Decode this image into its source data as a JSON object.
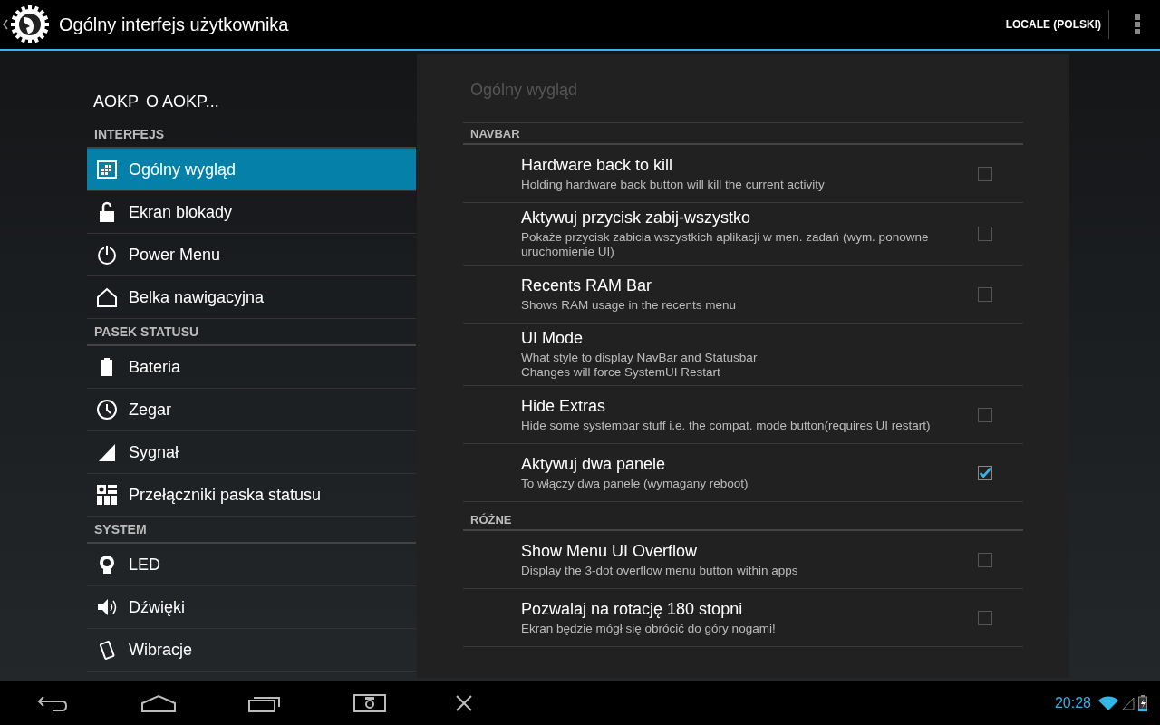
{
  "action_bar": {
    "title": "Ogólny interfejs użytkownika",
    "action": "LOCALE (POLSKI)"
  },
  "sidebar": {
    "header": {
      "logo_text": "AOKP",
      "label": "O AOKP..."
    },
    "sections": [
      {
        "title": "INTERFEJS",
        "items": [
          {
            "label": "Ogólny wygląd",
            "selected": true
          },
          {
            "label": "Ekran blokady",
            "selected": false
          },
          {
            "label": "Power Menu",
            "selected": false
          },
          {
            "label": "Belka nawigacyjna",
            "selected": false
          }
        ]
      },
      {
        "title": "PASEK STATUSU",
        "items": [
          {
            "label": "Bateria",
            "selected": false
          },
          {
            "label": "Zegar",
            "selected": false
          },
          {
            "label": "Sygnał",
            "selected": false
          },
          {
            "label": "Przełączniki paska statusu",
            "selected": false
          }
        ]
      },
      {
        "title": "SYSTEM",
        "items": [
          {
            "label": "LED",
            "selected": false
          },
          {
            "label": "Dźwięki",
            "selected": false
          },
          {
            "label": "Wibracje",
            "selected": false
          }
        ]
      }
    ]
  },
  "panel": {
    "title": "Ogólny wygląd",
    "categories": [
      {
        "title": "NAVBAR",
        "prefs": [
          {
            "kind": "checkbox",
            "title": "Hardware back to kill",
            "summary": [
              "Holding hardware back button will kill the current activity"
            ],
            "checked": false
          },
          {
            "kind": "checkbox",
            "title": "Aktywuj przycisk zabij-wszystko",
            "summary": [
              "Pokaże przycisk zabicia wszystkich aplikacji w men. zadań (wym. ponowne uruchomienie UI)"
            ],
            "checked": false
          },
          {
            "kind": "checkbox",
            "title": "Recents RAM Bar",
            "summary": [
              "Shows RAM usage in the recents menu"
            ],
            "checked": false
          },
          {
            "kind": "list",
            "title": "UI Mode",
            "summary": [
              "What style to display NavBar and Statusbar",
              "Changes will force SystemUI Restart"
            ]
          },
          {
            "kind": "checkbox",
            "title": "Hide Extras",
            "summary": [
              "Hide some systembar stuff i.e. the compat. mode button(requires UI restart)"
            ],
            "checked": false
          },
          {
            "kind": "checkbox",
            "title": "Aktywuj dwa panele",
            "summary": [
              "To włączy dwa panele (wymagany reboot)"
            ],
            "checked": true
          }
        ]
      },
      {
        "title": "RÓŻNE",
        "prefs": [
          {
            "kind": "checkbox",
            "title": "Show Menu UI Overflow",
            "summary": [
              "Display the 3-dot overflow menu button within apps"
            ],
            "checked": false
          },
          {
            "kind": "checkbox",
            "title": "Pozwalaj na rotację 180 stopni",
            "summary": [
              "Ekran będzie mógł się obrócić do góry nogami!"
            ],
            "checked": false
          }
        ]
      }
    ]
  },
  "system_bar": {
    "time": "20:28"
  }
}
